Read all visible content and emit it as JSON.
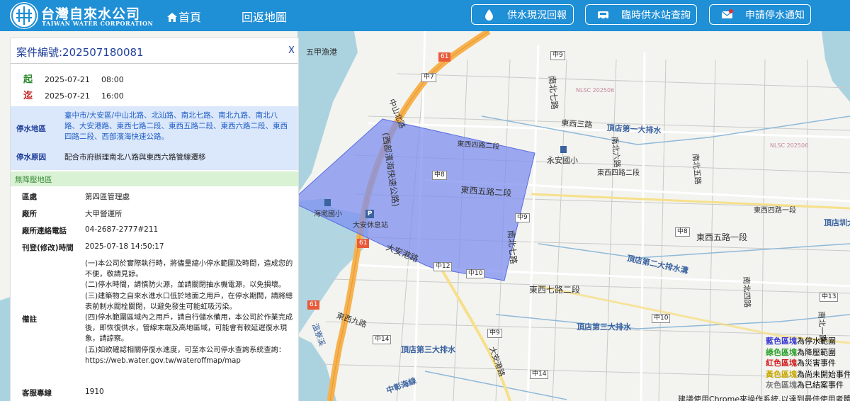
{
  "header": {
    "brand_zh": "台灣自來水公司",
    "brand_en": "TAIWAN WATER CORPORATION",
    "nav_home": "首頁",
    "nav_back": "回返地圖",
    "btn_report": "供水現況回報",
    "btn_station": "臨時供水站查詢",
    "btn_notify": "申請停水通知",
    "colors": {
      "bar": "#1f8fd6"
    }
  },
  "panel": {
    "case_title": "案件編號:202507180081",
    "close": "X",
    "start": {
      "tag": "起",
      "date": "2025-07-21",
      "time": "08:00"
    },
    "end": {
      "tag": "迄",
      "date": "2025-07-21",
      "time": "16:00"
    },
    "area_label": "停水地區",
    "area_value": "臺中市/大安區/中山北路、北汕路、南北七路、南北九路、南北八路、大安港路、東西七路二段、東西五路二段、東西六路二段、東西四路二段、西部濱海快速公路。",
    "reason_label": "停水原因",
    "reason_value": "配合市府辦理南北八路與東西六路管線遷移",
    "no_pressure": "無降壓地區",
    "district_label": "區處",
    "district_value": "第四區管理處",
    "office_label": "廠所",
    "office_value": "大甲營運所",
    "phone_label": "廠所連絡電話",
    "phone_value": "04-2687-2777#211",
    "published_label": "刊登(修改)時間",
    "published_value": "2025-07-18 14:50:17",
    "remarks_label": "備註",
    "remarks": [
      "(一)本公司於實際執行時，將儘量縮小停水範圍及時間，造成您的不便，敬請見諒。",
      "(二)停水時間，請慎防火源，並請關閉抽水機電源，以免損壞。",
      "(三)建築物之自來水進水口低於地面之用戶，在停水期間，請將總表前制水閥栓關閉，以避免發生可能虹吸污染。",
      "(四)停水範圍區域內之用戶，請自行儲水備用，本公司於作業完成後，即恢復供水，管線末端及高地區域，可能會有較延遲復水現象，請諒察。",
      "(五)如欲確認相關停復水進度，可至本公司停水查詢系統查詢：https://web.water.gov.tw/wateroffmap/map"
    ],
    "service_label": "客服專線",
    "service_value": "1910"
  },
  "map": {
    "labels": {
      "wuchia": "五甲漁港",
      "zhongshan_n": "中山北路",
      "west_coast_hwy": "(西部濱海快速公路)",
      "ew4_2": "東西四路二段",
      "ew5_2": "東西五路二段",
      "haixin": "海墘國小",
      "daan_rest": "大安休息站",
      "daan_harbor": "大安港路",
      "ns7_top": "南北七路",
      "ns7_mid": "南北七路",
      "ew3": "東西三路",
      "dingdian1": "頂店第一大排水",
      "ns6": "南北六路",
      "ns5": "南北五路",
      "yongan": "永安國小",
      "ew4_2b": "東西四路二段",
      "ew4_1": "東西四路一段",
      "dingdian_r": "頂店圳大",
      "ew5_1": "東西五路一段",
      "dingdian2": "頂店第二大排水溝",
      "ew7_2": "東西七路二段",
      "ns4": "南北四路",
      "ew9": "東西九路",
      "dingdian3": "頂店第三大排水",
      "dingdian3b": "頂店第三大排水",
      "daan_harbor2": "大安港路",
      "ns_r": "南北一路",
      "bottom_left": "中彰海線",
      "sea_label": "溫寮溪"
    },
    "tags": {
      "t61a": "61",
      "t61b": "61",
      "t61c": "61",
      "m7": "中7",
      "m9": "中9",
      "m8": "中8",
      "m9b": "中9",
      "m8b": "中8",
      "m12": "中12",
      "m10": "中10",
      "m14": "中14",
      "m9c": "中9",
      "m10b": "中10",
      "m13": "中13",
      "m14b": "中14"
    },
    "nlsc1": "NLSC 202506",
    "nlsc2": "NLSC 202506"
  },
  "legend": {
    "blue_sw": "藍色區塊",
    "blue_txt": "為停水範圍",
    "green_sw": "綠色區塊",
    "green_txt": "為降壓範圍",
    "red_sw": "紅色區塊",
    "red_txt": "為災害事件",
    "yellow_sw": "黃色區塊",
    "yellow_txt": "為尚未開始事件",
    "gray_sw": "灰色區塊",
    "gray_txt": "為已結案事件",
    "colors": {
      "blue": "#3a3ad0",
      "green": "#2aa02a",
      "red": "#d02020",
      "yellow": "#c8a800",
      "gray": "#808080"
    }
  },
  "footer_note": "建議使用Chrome來操作系統,以達到最佳使用者體驗"
}
